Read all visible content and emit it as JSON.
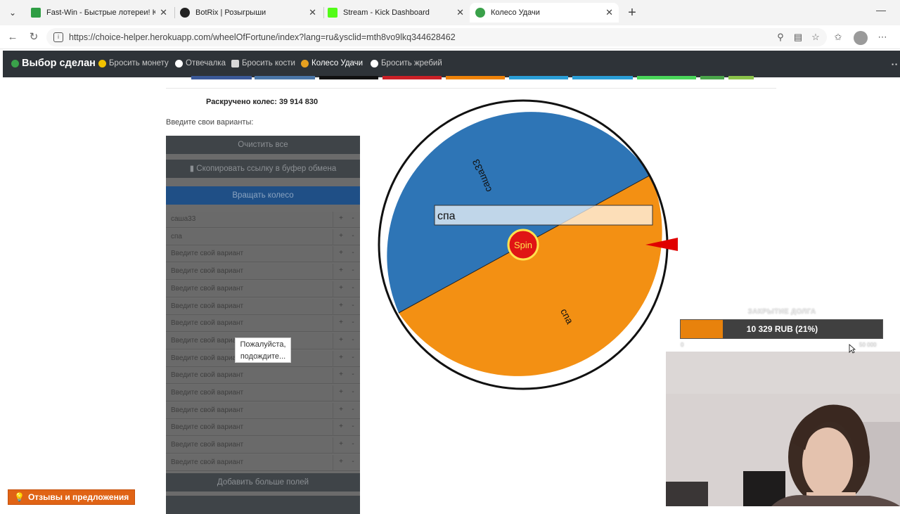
{
  "browser": {
    "tabs": [
      {
        "title": "Fast-Win - Быстрые лотереи! Ком",
        "favicon_color": "#2f9e44"
      },
      {
        "title": "BotRix | Розыгрыши",
        "favicon_color": "#222222"
      },
      {
        "title": "Stream - Kick Dashboard",
        "favicon_color": "#53fc18"
      },
      {
        "title": "Колесо Удачи",
        "favicon_color": "#3aa14a"
      }
    ],
    "url": "https://choice-helper.herokuapp.com/wheelOfFortune/index?lang=ru&ysclid=mth8vo9lkq344628462"
  },
  "nav": {
    "brand": "Выбор сделан",
    "links": [
      {
        "label": "Бросить монету",
        "icon": "coin-icon"
      },
      {
        "label": "Отвечалка",
        "icon": "question-icon"
      },
      {
        "label": "Бросить кости",
        "icon": "dice-icon"
      },
      {
        "label": "Колесо Удачи",
        "icon": "wheel-icon"
      },
      {
        "label": "Бросить жребий",
        "icon": "lot-icon"
      }
    ]
  },
  "stats": {
    "spun": "Раскручено колес: 39 914 830"
  },
  "form": {
    "prompt": "Введите свои варианты:",
    "clear_button": "Очистить все",
    "copy_button": "Скопировать ссылку в буфер обмена",
    "spin_button": "Вращать колесо",
    "add_more_button": "Добавить больше полей",
    "plus": "+",
    "minus": "-",
    "options": [
      "саша33",
      "спа",
      "Введите свой вариант",
      "Введите свой вариант",
      "Введите свой вариант",
      "Введите свой вариант",
      "Введите свой вариант",
      "Введите свой вариант",
      "Введите свой вариант",
      "Введите свой вариант",
      "Введите свой вариант",
      "Введите свой вариант",
      "Введите свой вариант",
      "Введите свой вариант",
      "Введите свой вариант"
    ]
  },
  "tooltip": {
    "line1": "Пожалуйста,",
    "line2": "подождите..."
  },
  "wheel": {
    "segments": [
      {
        "label": "саша33",
        "color": "#2e75b6"
      },
      {
        "label": "спа",
        "color": "#f39013"
      }
    ],
    "center_label": "Spin",
    "result_label": "спа"
  },
  "debt_widget": {
    "title": "ЗАКРЫТИЕ ДОЛГА",
    "amount": "10 329 RUB (21%)",
    "progress": 0.21,
    "min": "0",
    "max": "50 000"
  },
  "feedback": {
    "label": "Отзывы и предложения"
  }
}
